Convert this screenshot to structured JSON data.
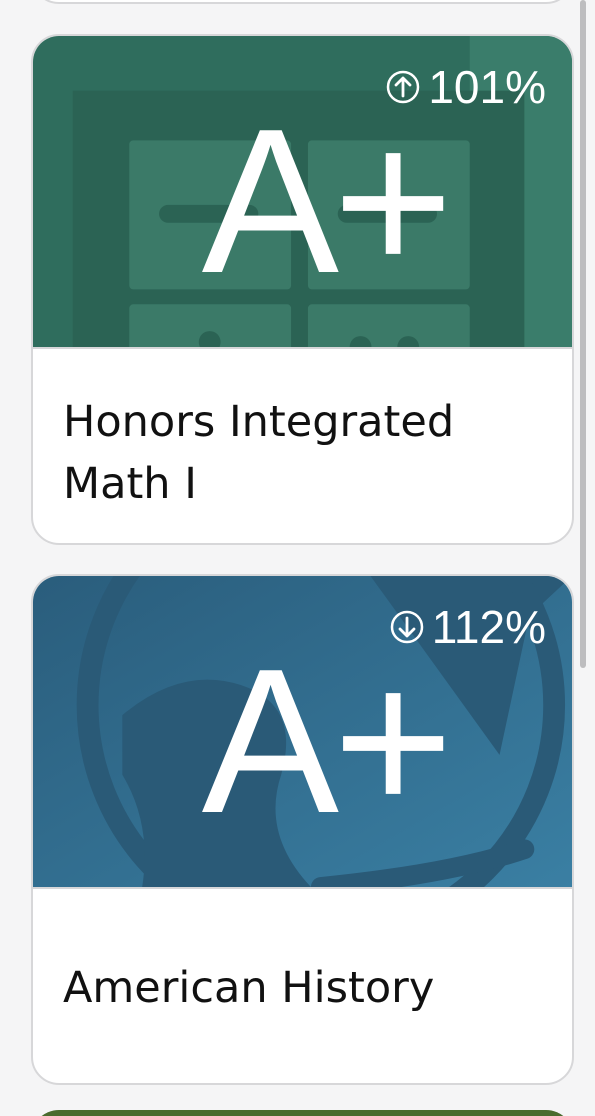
{
  "courses": [
    {
      "name": "Honors Integrated Math I",
      "grade": "A+",
      "percent": "101%",
      "trend_icon": "arrow-up-circle-icon",
      "color": "#2f6d5d"
    },
    {
      "name": "American History",
      "grade": "A+",
      "percent": "112%",
      "trend_icon": "arrow-down-circle-icon",
      "color": "#2f6a8c"
    }
  ],
  "colors": {
    "background": "#f5f5f6",
    "card_border": "#d7d7d9",
    "math_banner": "#2f6d5d",
    "history_banner": "#2f6a8c",
    "partial_card": "#4a6b2e"
  }
}
